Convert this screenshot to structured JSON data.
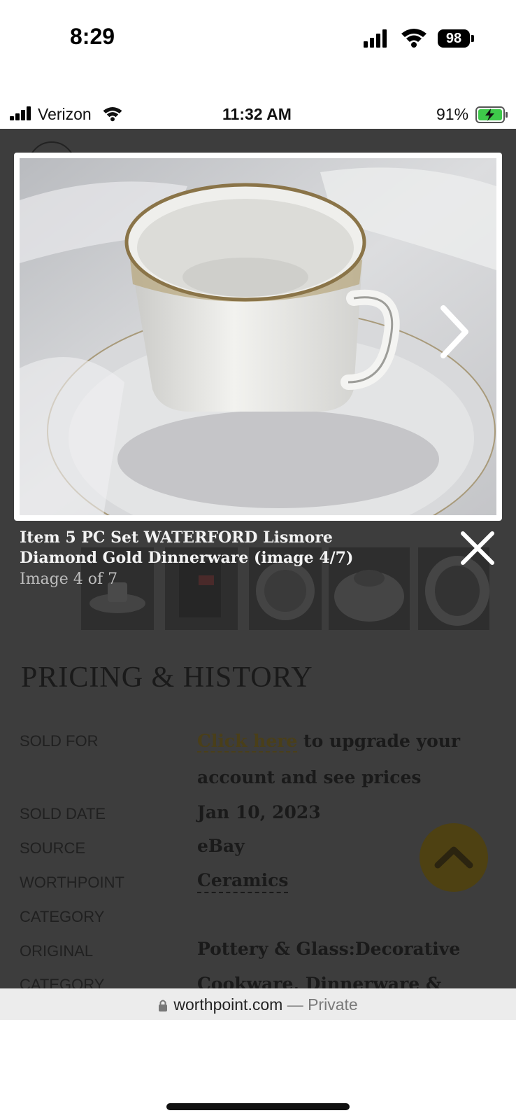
{
  "device_status": {
    "time": "8:29",
    "battery": "98"
  },
  "screenshot_status": {
    "carrier": "Verizon",
    "time": "11:32 AM",
    "battery_pct": "91%"
  },
  "lightbox": {
    "title": "Item 5 PC Set WATERFORD Lismore Diamond Gold Dinnerware (image 4/7)",
    "counter": "Image 4 of 7",
    "thumbnail_count": 5
  },
  "pricing": {
    "heading": "PRICING & HISTORY",
    "sold_for_label": "SOLD FOR",
    "upgrade_link": "Click here",
    "upgrade_text_1": "to upgrade your",
    "upgrade_text_2": "account and see prices",
    "sold_date_label": "SOLD DATE",
    "sold_date_value": "Jan 10, 2023",
    "source_label": "SOURCE",
    "source_value": "eBay",
    "wp_category_label_1": "WORTHPOINT",
    "wp_category_label_2": "CATEGORY",
    "wp_category_value": "Ceramics",
    "orig_category_label_1": "ORIGINAL",
    "orig_category_label_2": "CATEGORY",
    "orig_category_value_1": "Pottery & Glass:Decorative",
    "orig_category_value_2": "Cookware, Dinnerware &"
  },
  "browser": {
    "domain": "worthpoint.com",
    "mode": "— Private"
  },
  "colors": {
    "overlay": "#3d3d3d",
    "accent_gold": "#4e4112",
    "link_gold": "#4a3f19"
  }
}
